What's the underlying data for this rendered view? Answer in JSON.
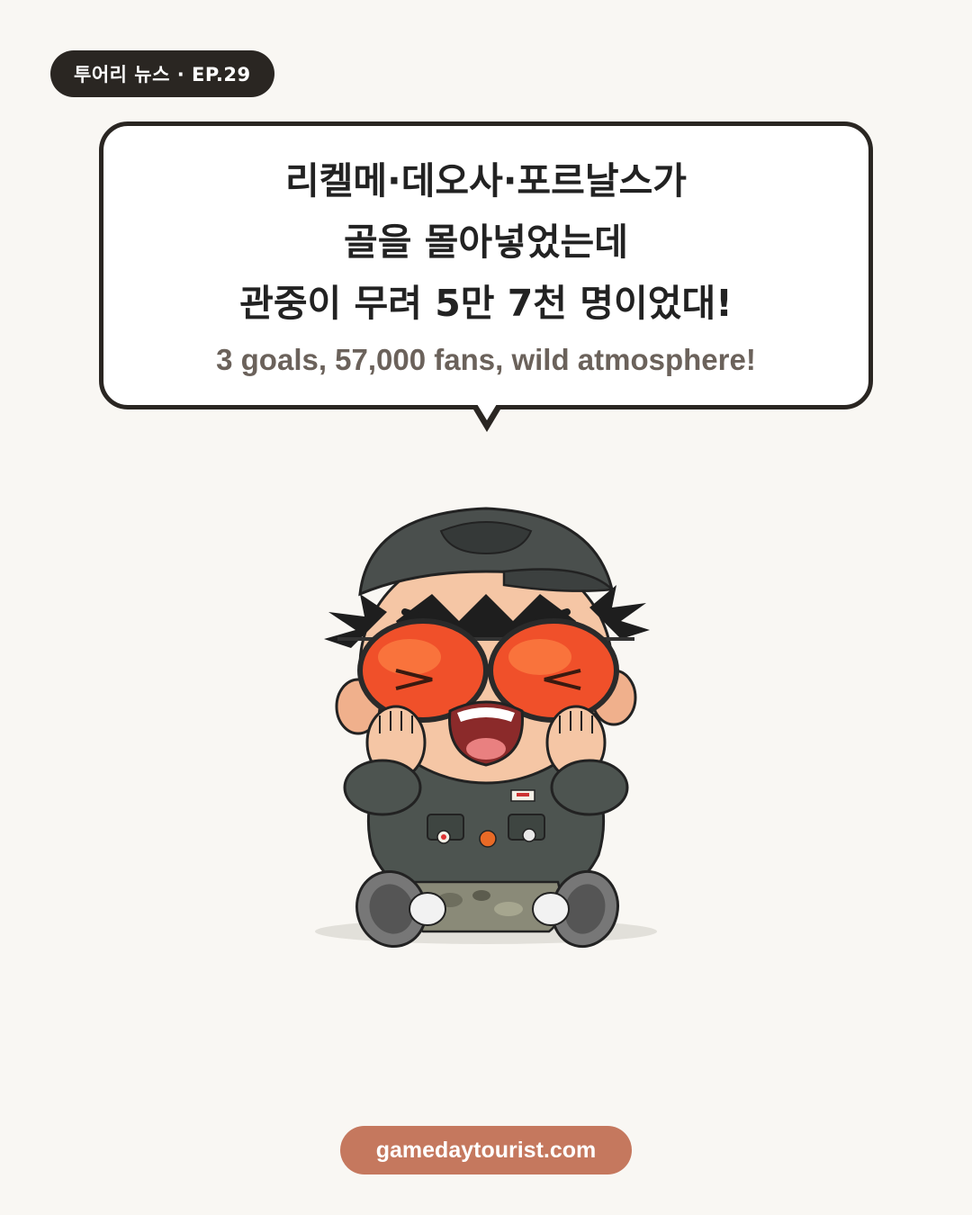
{
  "episode_badge": "투어리 뉴스 · EP.29",
  "bubble": {
    "headline_lines": [
      "리켈메·데오사·포르날스가",
      "골을 몰아넣었는데",
      "관중이 무려 5만 7천 명이었대!"
    ],
    "subline": "3 goals, 57,000 fans, wild atmosphere!"
  },
  "mascot": {
    "icon": "cheering-kid-mascot-icon"
  },
  "footer": {
    "site": "gamedaytourist.com"
  },
  "colors": {
    "background": "#f9f7f3",
    "dark": "#2a2622",
    "accent": "#c5785e",
    "lens": "#f0502a"
  }
}
